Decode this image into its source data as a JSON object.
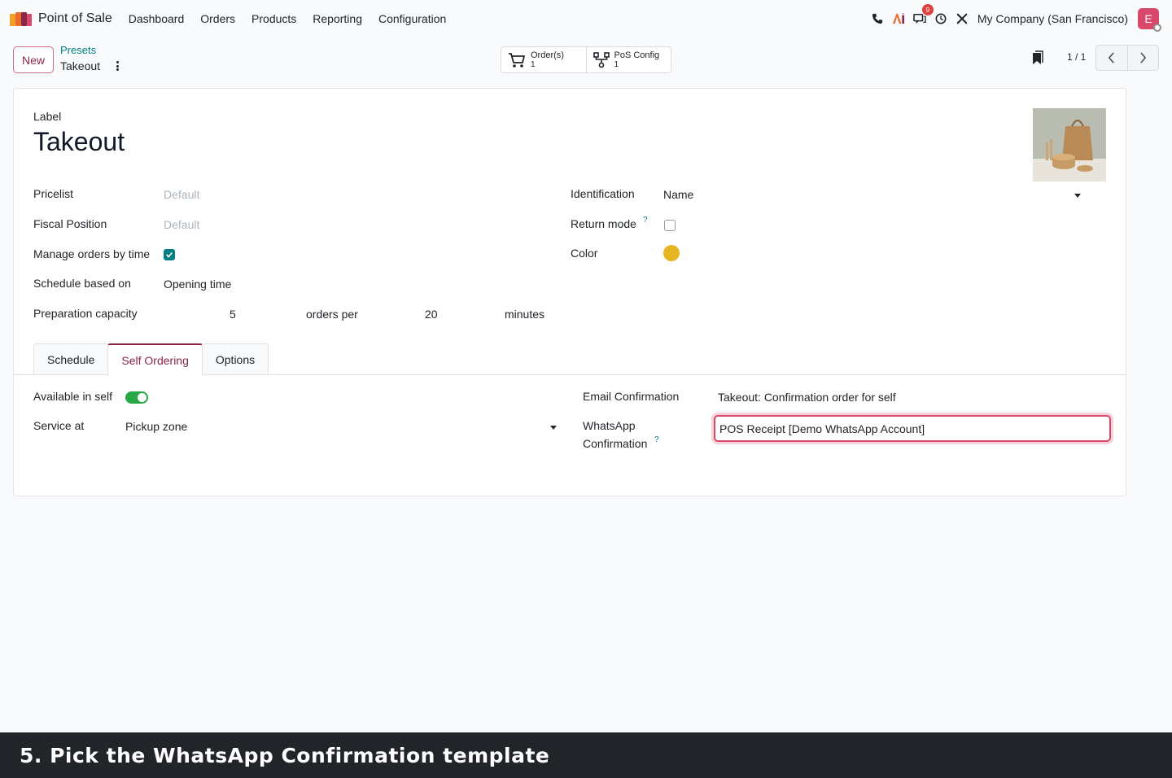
{
  "navbar": {
    "app_name": "Point of Sale",
    "menu": [
      "Dashboard",
      "Orders",
      "Products",
      "Reporting",
      "Configuration"
    ],
    "messages_badge": "9",
    "company": "My Company (San Francisco)",
    "avatar_letter": "E"
  },
  "control_panel": {
    "new_label": "New",
    "breadcrumb_parent": "Presets",
    "breadcrumb_current": "Takeout",
    "smart_buttons": [
      {
        "label": "Order(s)",
        "value": "1",
        "icon": "cart-icon"
      },
      {
        "label": "PoS Config",
        "value": "1",
        "icon": "sitemap-icon"
      }
    ],
    "pager": "1 / 1"
  },
  "form": {
    "label_caption": "Label",
    "title": "Takeout",
    "left_fields": {
      "pricelist_label": "Pricelist",
      "pricelist_placeholder": "Default",
      "fiscal_label": "Fiscal Position",
      "fiscal_placeholder": "Default",
      "manage_label": "Manage orders by time",
      "manage_checked": true,
      "schedule_label": "Schedule based on",
      "schedule_value": "Opening time",
      "capacity_label": "Preparation capacity",
      "capacity_value": "5",
      "orders_per": "orders per",
      "minutes_value": "20",
      "minutes_label": "minutes"
    },
    "right_fields": {
      "identification_label": "Identification",
      "identification_value": "Name",
      "return_label": "Return mode",
      "return_checked": false,
      "color_label": "Color",
      "color_value": "#e5b622",
      "help_mark": "?"
    },
    "tabs": [
      "Schedule",
      "Self Ordering",
      "Options"
    ],
    "active_tab": "Self Ordering",
    "self_ordering": {
      "available_label": "Available in self",
      "available_on": true,
      "service_label": "Service at",
      "service_value": "Pickup zone",
      "email_label": "Email Confirmation",
      "email_value": "Takeout: Confirmation order for self",
      "whatsapp_label_1": "WhatsApp",
      "whatsapp_label_2": "Confirmation",
      "whatsapp_value": "POS Receipt [Demo WhatsApp Account]"
    }
  },
  "caption": "5. Pick the WhatsApp Confirmation template",
  "colors": {
    "brand": "#8a2647",
    "teal": "#017e84",
    "toggle": "#28a745",
    "focus": "#d9486a"
  }
}
